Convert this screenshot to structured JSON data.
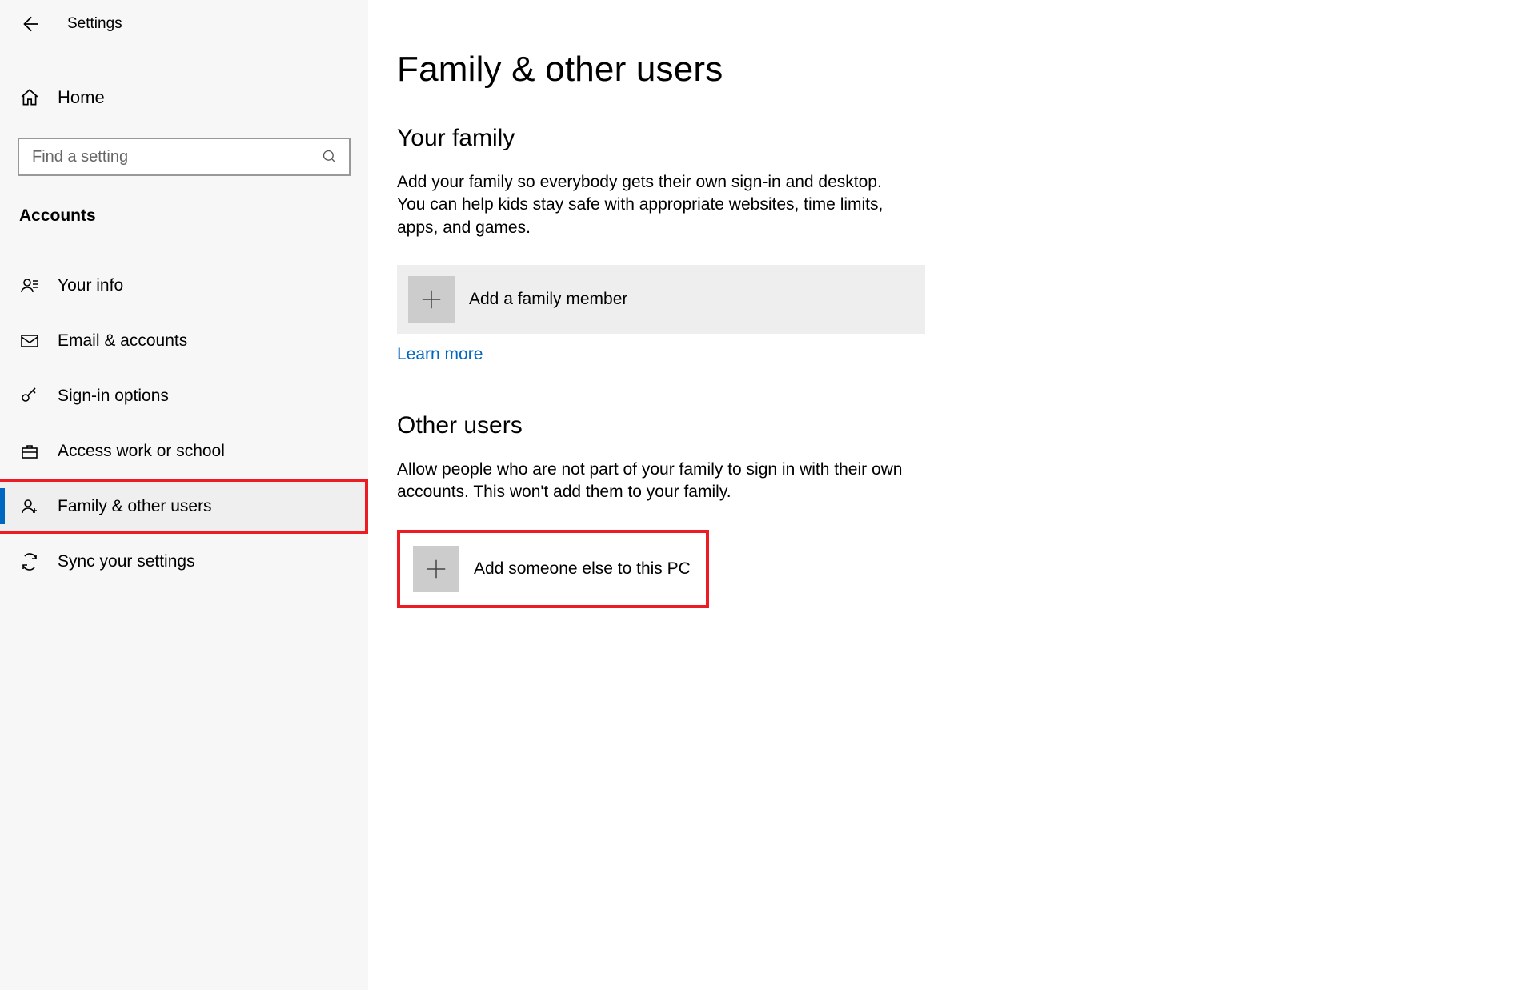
{
  "header": {
    "settings_label": "Settings"
  },
  "sidebar": {
    "home_label": "Home",
    "search_placeholder": "Find a setting",
    "section_heading": "Accounts",
    "items": [
      {
        "label": "Your info"
      },
      {
        "label": "Email & accounts"
      },
      {
        "label": "Sign-in options"
      },
      {
        "label": "Access work or school"
      },
      {
        "label": "Family & other users"
      },
      {
        "label": "Sync your settings"
      }
    ]
  },
  "main": {
    "page_title": "Family & other users",
    "family": {
      "heading": "Your family",
      "body": "Add your family so everybody gets their own sign-in and desktop. You can help kids stay safe with appropriate websites, time limits, apps, and games.",
      "add_label": "Add a family member",
      "learn_more": "Learn more"
    },
    "other": {
      "heading": "Other users",
      "body": "Allow people who are not part of your family to sign in with their own accounts. This won't add them to your family.",
      "add_label": "Add someone else to this PC"
    }
  }
}
